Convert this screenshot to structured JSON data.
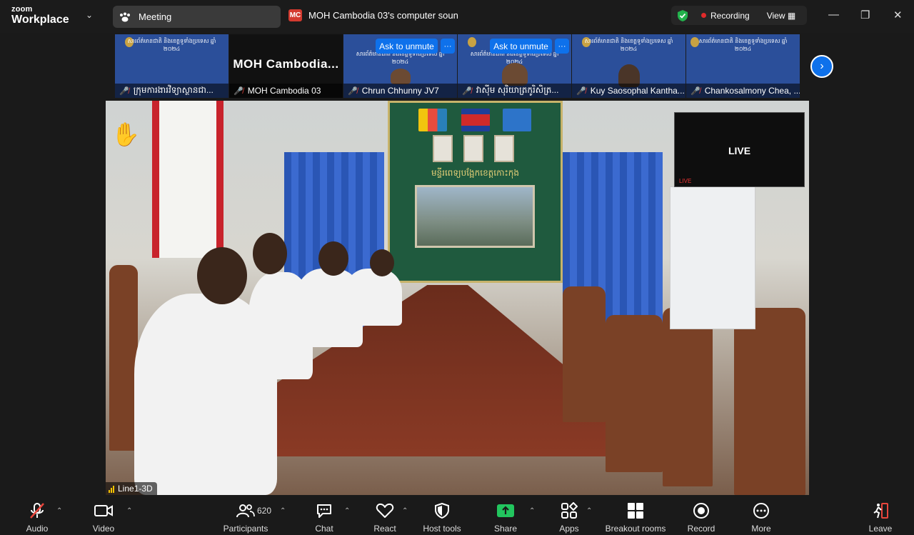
{
  "titlebar": {
    "logo_top": "zoom",
    "logo_bottom": "Workplace",
    "meeting_label": "Meeting",
    "share_initials": "MC",
    "share_text": "MOH Cambodia 03's computer soun",
    "recording_label": "Recording",
    "view_label": "View",
    "colors": {
      "recording_dot": "#e02a2a",
      "shield": "#22b24c",
      "share_badge": "#d33a2f"
    }
  },
  "gallery": {
    "banner_text": "សារព័ត៌មានជាតិ និងខេត្តទូទាំងប្រទេស ឆ្នាំ ២០២៤",
    "unmute_label": "Ask to unmute",
    "more_label": "···",
    "tiles": [
      {
        "name": "ក្រុមការងារវិទ្យាស្ថានជា..."
      },
      {
        "name": "MOH Cambodia 03",
        "big_text": "MOH  Cambodia..."
      },
      {
        "name": "Chrun Chhunny JV7"
      },
      {
        "name": "វាស៊ីម សុរិយាត្រកូរិសិត្រ..."
      },
      {
        "name": "Kuy Saosophal Kantha..."
      },
      {
        "name": "Chankosalmony Chea, ..."
      }
    ],
    "accent": "#0e71eb"
  },
  "video": {
    "wall_title": "មន្ទីរពេទ្យបង្អែកខេត្តកោះកុង",
    "live_text": "LIVE",
    "live_sub": "LIVE",
    "speaker_label": "Line1-3D",
    "raised_hand": "✋"
  },
  "toolbar": {
    "audio": "Audio",
    "video": "Video",
    "participants": "Participants",
    "participants_count": "620",
    "chat": "Chat",
    "react": "React",
    "host_tools": "Host tools",
    "share": "Share",
    "apps": "Apps",
    "breakout": "Breakout rooms",
    "record": "Record",
    "more": "More",
    "leave": "Leave",
    "colors": {
      "share": "#22c55e",
      "mute": "#e8453c",
      "leave": "#e8453c"
    }
  }
}
